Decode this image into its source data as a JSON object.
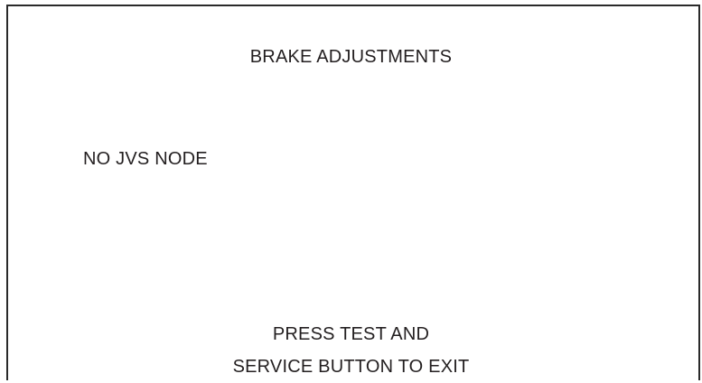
{
  "screen": {
    "title": "BRAKE ADJUSTMENTS",
    "status": "NO JVS NODE",
    "footer_line_1": "PRESS TEST AND",
    "footer_line_2": "SERVICE BUTTON TO EXIT"
  },
  "colors": {
    "background": "#ffffff",
    "text": "#231f20",
    "frame": "#2a2a2a"
  }
}
